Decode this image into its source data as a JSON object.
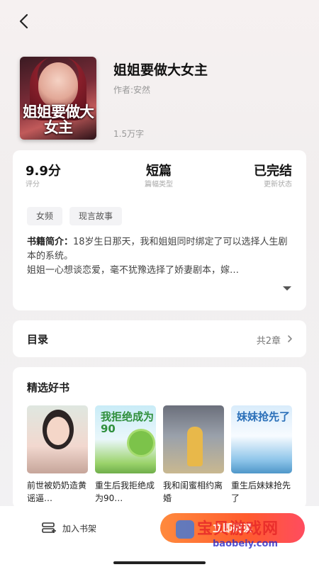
{
  "nav": {
    "back_icon": "chevron-left-icon"
  },
  "book": {
    "title": "姐姐要做大女主",
    "cover_title": "姐姐要做大女主",
    "author": "作者:安然",
    "wordcount": "1.5万字"
  },
  "stats": [
    {
      "value": "9.9分",
      "label": "评分"
    },
    {
      "value": "短篇",
      "label": "篇幅类型"
    },
    {
      "value": "已完结",
      "label": "更新状态"
    }
  ],
  "tags": [
    "女频",
    "现言故事"
  ],
  "intro": {
    "label": "书籍简介：",
    "text_line1": "18岁生日那天，我和姐姐同时绑定了可以选择人生剧本的系统。",
    "text_line2": "姐姐一心想谈恋爱，毫不犹豫选择了娇妻剧本，嫁…",
    "expand_icon": "triangle-down-icon"
  },
  "toc": {
    "label": "目录",
    "count": "共2章",
    "chevron_icon": "chevron-right-icon"
  },
  "picks": {
    "title": "精选好书",
    "items": [
      {
        "title": "前世被奶奶造黄谣逼…",
        "cover_text": ""
      },
      {
        "title": "重生后我拒绝成为90…",
        "cover_text": "我拒绝成为90"
      },
      {
        "title": "我和闺蜜相约离婚",
        "cover_text": ""
      },
      {
        "title": "重生后妹妹抢先了",
        "cover_text": "妹妹抢先了"
      }
    ]
  },
  "bottom": {
    "shelf_label": "加入书架",
    "shelf_icon": "bookshelf-icon",
    "read_label": "立即阅读"
  },
  "watermark": {
    "main": "宝贝游戏网",
    "sub": "baobeiy.com"
  },
  "colors": {
    "accent_start": "#ff8a3d",
    "accent_end": "#ff4c5f"
  }
}
